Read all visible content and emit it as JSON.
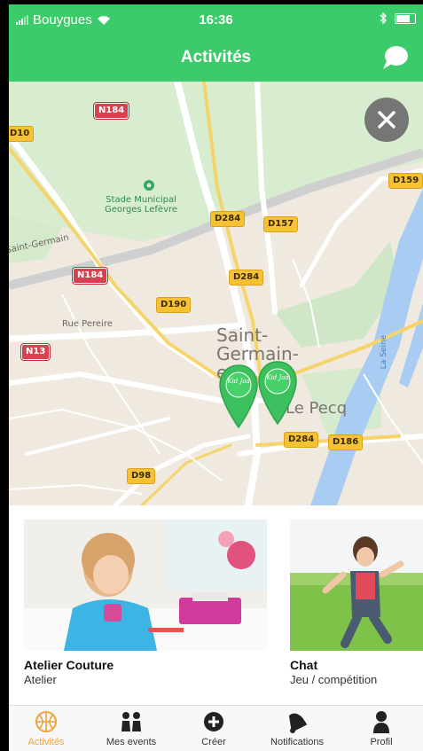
{
  "status_bar": {
    "carrier": "Bouygues",
    "time": "16:36"
  },
  "header": {
    "title": "Activités",
    "chat_icon": "chat-bubble-icon"
  },
  "map": {
    "close_icon": "close-icon",
    "roads": [
      "N184",
      "N184",
      "D284",
      "D157",
      "D284",
      "D190",
      "N13",
      "D159",
      "D284",
      "D186",
      "D98",
      "D10"
    ],
    "labels": {
      "stadium_line1": "Stade Municipal",
      "stadium_line2": "Georges Lefèvre",
      "saint_germain_road": "Saint-Germain",
      "rue_pereire": "Rue Pereire",
      "city1": "Saint-",
      "city2": "Germain-",
      "city3": "e",
      "le_pecq": "Le Pecq",
      "la_seine": "La Seine"
    },
    "pin_text": "Kid Jaa"
  },
  "cards": [
    {
      "name": "Atelier Couture",
      "category": "Atelier"
    },
    {
      "name": "Chat",
      "category": "Jeu / compétition"
    }
  ],
  "tabs": [
    {
      "label": "Activités",
      "icon": "basketball-icon",
      "active": true
    },
    {
      "label": "Mes events",
      "icon": "people-icon",
      "active": false
    },
    {
      "label": "Créer",
      "icon": "plus-circle-icon",
      "active": false
    },
    {
      "label": "Notifications",
      "icon": "bell-icon",
      "active": false
    },
    {
      "label": "Profil",
      "icon": "person-icon",
      "active": false
    }
  ],
  "colors": {
    "brand_green": "#3ccb6a",
    "active_tab": "#f0a23c"
  }
}
